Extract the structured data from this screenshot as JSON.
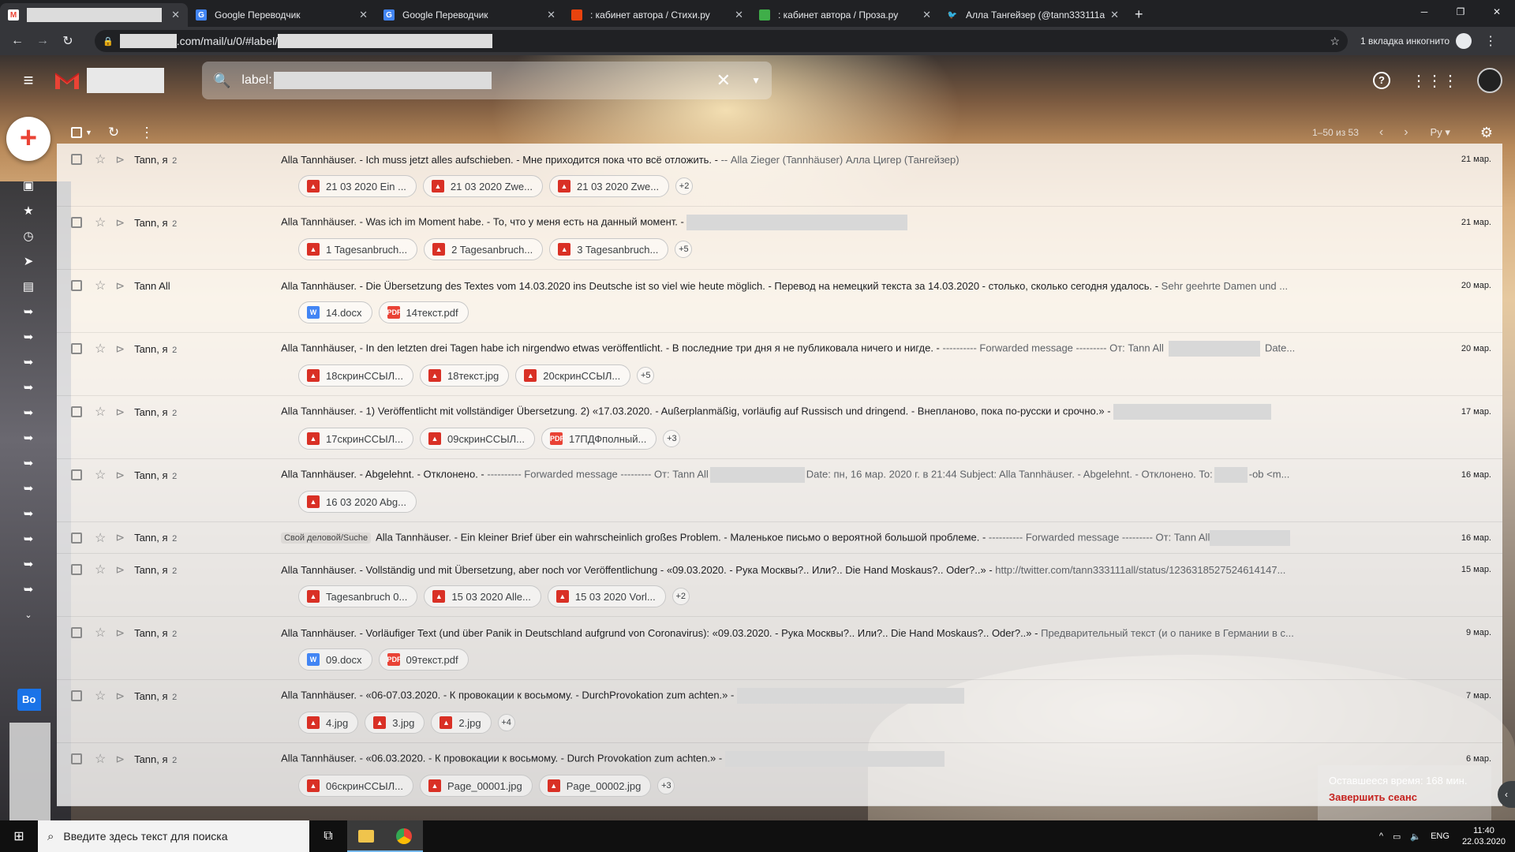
{
  "browser": {
    "tabs": [
      {
        "title": "",
        "redacted": true,
        "favicon": "gmail-icon",
        "active": true
      },
      {
        "title": "Google Переводчик",
        "favicon": "google-translate-icon"
      },
      {
        "title": "Google Переводчик",
        "favicon": "google-translate-icon"
      },
      {
        "title": ": кабинет автора / Стихи.ру",
        "favicon": "stihi-icon"
      },
      {
        "title": ": кабинет автора / Проза.ру",
        "favicon": "proza-icon"
      },
      {
        "title": "Алла Тангейзер (@tann333111a",
        "favicon": "twitter-icon"
      }
    ],
    "url_suffix": ".com/mail/u/0/#label/",
    "incognito_label": "1 вкладка инкогнито"
  },
  "gmail": {
    "search_prefix": "label:",
    "range": "1–50 из 53",
    "lang": "Ру"
  },
  "emails": [
    {
      "sender": "Tann, я",
      "count": "2",
      "subject": "Alla Tannhäuser. - Ich muss jetzt alles aufschieben. - Мне приходится пока что всё отложить. - ",
      "snippet": "-- Alla Zieger (Tannhäuser) Алла Цигер (Тангейзер)",
      "date": "21 мар.",
      "chips": [
        {
          "name": "21 03 2020 Ein ...",
          "type": "img"
        },
        {
          "name": "21 03 2020 Zwe...",
          "type": "img"
        },
        {
          "name": "21 03 2020 Zwe...",
          "type": "img"
        }
      ],
      "more": "+2"
    },
    {
      "sender": "Tann, я",
      "count": "2",
      "subject": "Alla Tannhäuser. - Was ich im Moment habe. - То, что у меня есть на данный момент. - ",
      "snippet": "",
      "date": "21 мар.",
      "chips": [
        {
          "name": "1 Tagesanbruch...",
          "type": "img"
        },
        {
          "name": "2 Tagesanbruch...",
          "type": "img"
        },
        {
          "name": "3 Tagesanbruch...",
          "type": "img"
        }
      ],
      "more": "+5"
    },
    {
      "sender": "Tann All",
      "count": "",
      "subject": "Alla Tannhäuser. - Die Übersetzung des Textes vom 14.03.2020 ins Deutsche ist so viel wie heute möglich. - Перевод на немецкий текста за 14.03.2020 - столько, сколько сегодня удалось. - ",
      "snippet": "Sehr geehrte Damen und ...",
      "date": "20 мар.",
      "chips": [
        {
          "name": "14.docx",
          "type": "doc"
        },
        {
          "name": "14текст.pdf",
          "type": "pdf"
        }
      ],
      "more": ""
    },
    {
      "sender": "Tann, я",
      "count": "2",
      "subject": "Alla Tannhäuser, - In den letzten drei Tagen habe ich nirgendwo etwas veröffentlicht. - В последние три дня я не публиковала ничего и нигде. - ",
      "snippet": "---------- Forwarded message --------- От: Tann All",
      "snippet2": "Date...",
      "date": "20 мар.",
      "chips": [
        {
          "name": "18скринССЫЛ...",
          "type": "img"
        },
        {
          "name": "18текст.jpg",
          "type": "img"
        },
        {
          "name": "20скринССЫЛ...",
          "type": "img"
        }
      ],
      "more": "+5"
    },
    {
      "sender": "Tann, я",
      "count": "2",
      "subject": "Alla Tannhäuser. - 1) Veröffentlicht mit vollständiger Übersetzung. 2) «17.03.2020. - Außerplanmäßig, vorläufig auf Russisch und dringend. - Внепланово, пока по-русски и срочно.» - ",
      "snippet": "",
      "date": "17 мар.",
      "chips": [
        {
          "name": "17скринССЫЛ...",
          "type": "img"
        },
        {
          "name": "09скринССЫЛ...",
          "type": "img"
        },
        {
          "name": "17ПДФполный...",
          "type": "pdf"
        }
      ],
      "more": "+3"
    },
    {
      "sender": "Tann, я",
      "count": "2",
      "subject": "Alla Tannhäuser. - Abgelehnt. - Отклонено. - ",
      "snippet": "---------- Forwarded message --------- От: Tann All",
      "snippet2": "Date: пн, 16 мар. 2020 г. в 21:44 Subject: Alla Tannhäuser. - Abgelehnt. - Отклонено. To:",
      "snippet3": "-ob <m...",
      "date": "16 мар.",
      "chips": [
        {
          "name": "16 03 2020 Abg...",
          "type": "img"
        }
      ],
      "more": ""
    },
    {
      "sender": "Tann, я",
      "count": "2",
      "label": "Свой деловой/Suche",
      "subject": "Alla Tannhäuser. - Ein kleiner Brief über ein wahrscheinlich großes Problem. - Маленькое письмо о вероятной большой проблеме. - ",
      "snippet": "---------- Forwarded message --------- От: Tann All",
      "date": "16 мар.",
      "chips": [],
      "more": ""
    },
    {
      "sender": "Tann, я",
      "count": "2",
      "subject": "Alla Tannhäuser. - Vollständig und mit Übersetzung, aber noch vor Veröffentlichung - «09.03.2020. - Рука Москвы?.. Или?.. Die Hand Moskaus?.. Oder?..» - ",
      "snippet": "http://twitter.com/tann333111all/status/1236318527524614147...",
      "date": "15 мар.",
      "chips": [
        {
          "name": "Tagesanbruch 0...",
          "type": "img"
        },
        {
          "name": "15 03 2020 Alle...",
          "type": "img"
        },
        {
          "name": "15 03 2020 Vorl...",
          "type": "img"
        }
      ],
      "more": "+2"
    },
    {
      "sender": "Tann, я",
      "count": "2",
      "subject": "Alla Tannhäuser. - Vorläufiger Text (und über Panik in Deutschland aufgrund von Coronavirus): «09.03.2020. - Рука Москвы?.. Или?.. Die Hand Moskaus?.. Oder?..» - ",
      "snippet": "Предварительный текст (и о панике в Германии в с...",
      "date": "9 мар.",
      "chips": [
        {
          "name": "09.docx",
          "type": "doc"
        },
        {
          "name": "09текст.pdf",
          "type": "pdf"
        }
      ],
      "more": ""
    },
    {
      "sender": "Tann, я",
      "count": "2",
      "subject": "Alla Tannhäuser. - «06-07.03.2020. - К провокации к восьмому. - DurchProvokation zum achten.» - ",
      "snippet": "",
      "date": "7 мар.",
      "chips": [
        {
          "name": "4.jpg",
          "type": "img"
        },
        {
          "name": "3.jpg",
          "type": "img"
        },
        {
          "name": "2.jpg",
          "type": "img"
        }
      ],
      "more": "+4"
    },
    {
      "sender": "Tann, я",
      "count": "2",
      "subject": "Alla Tannhäuser. - «06.03.2020. - К провокации к восьмому. - Durch Provokation zum achten.» - ",
      "snippet": "",
      "date": "6 мар.",
      "chips": [
        {
          "name": "06скринССЫЛ...",
          "type": "img"
        },
        {
          "name": "Page_00001.jpg",
          "type": "img"
        },
        {
          "name": "Page_00002.jpg",
          "type": "img"
        }
      ],
      "more": "+3"
    }
  ],
  "session": {
    "remaining": "Оставшееся время: 168 мин.",
    "end": "Завершить сеанс"
  },
  "side_tab": "Bo",
  "taskbar": {
    "search_placeholder": "Введите здесь текст для поиска",
    "lang": "ENG",
    "time": "11:40",
    "date": "22.03.2020"
  }
}
